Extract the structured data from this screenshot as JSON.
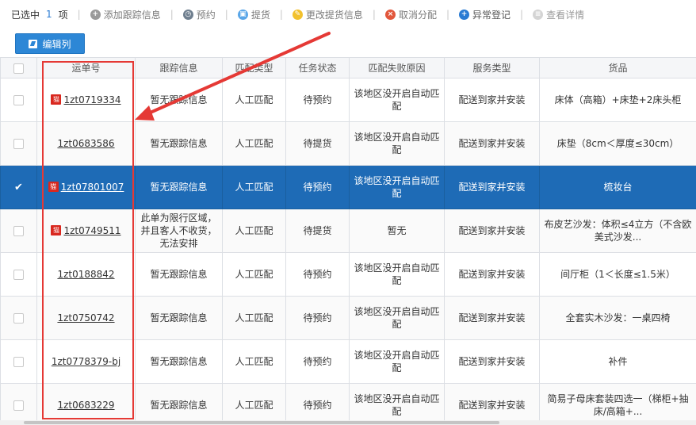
{
  "toolbar": {
    "selected_label": "已选中",
    "selected_count": "1",
    "selected_unit": "项",
    "items": [
      {
        "label": "添加跟踪信息",
        "icon": "add-circle-icon"
      },
      {
        "label": "预约",
        "icon": "clock-icon"
      },
      {
        "label": "提货",
        "icon": "pickup-icon"
      },
      {
        "label": "更改提货信息",
        "icon": "edit-icon"
      },
      {
        "label": "取消分配",
        "icon": "cancel-icon"
      },
      {
        "label": "异常登记",
        "icon": "exception-add-icon"
      },
      {
        "label": "查看详情",
        "icon": "detail-icon"
      }
    ]
  },
  "edit_columns_label": "编辑列",
  "table": {
    "headers": [
      "运单号",
      "跟踪信息",
      "匹配类型",
      "任务状态",
      "匹配失败原因",
      "服务类型",
      "货品"
    ],
    "rows": [
      {
        "tmall": true,
        "waybill": "1zt0719334",
        "tracking": "暂无跟踪信息",
        "match_type": "人工匹配",
        "status": "待预约",
        "fail_reason": "该地区没开启自动匹配",
        "service": "配送到家并安装",
        "goods": "床体（高箱）+床垫+2床头柜"
      },
      {
        "tmall": false,
        "waybill": "1zt0683586",
        "tracking": "暂无跟踪信息",
        "match_type": "人工匹配",
        "status": "待提货",
        "fail_reason": "该地区没开启自动匹配",
        "service": "配送到家并安装",
        "goods": "床垫（8cm＜厚度≤30cm）"
      },
      {
        "tmall": true,
        "waybill": "1zt07801007",
        "tracking": "暂无跟踪信息",
        "match_type": "人工匹配",
        "status": "待预约",
        "fail_reason": "该地区没开启自动匹配",
        "service": "配送到家并安装",
        "goods": "梳妆台",
        "selected": true
      },
      {
        "tmall": true,
        "waybill": "1zt0749511",
        "tracking": "此单为限行区域，并且客人不收货，无法安排",
        "match_type": "人工匹配",
        "status": "待提货",
        "fail_reason": "暂无",
        "service": "配送到家并安装",
        "goods": "布皮艺沙发：体积≤4立方（不含欧美式沙发..."
      },
      {
        "tmall": false,
        "waybill": "1zt0188842",
        "tracking": "暂无跟踪信息",
        "match_type": "人工匹配",
        "status": "待预约",
        "fail_reason": "该地区没开启自动匹配",
        "service": "配送到家并安装",
        "goods": "间厅柜（1＜长度≤1.5米）"
      },
      {
        "tmall": false,
        "waybill": "1zt0750742",
        "tracking": "暂无跟踪信息",
        "match_type": "人工匹配",
        "status": "待预约",
        "fail_reason": "该地区没开启自动匹配",
        "service": "配送到家并安装",
        "goods": "全套实木沙发：一桌四椅"
      },
      {
        "tmall": false,
        "waybill": "1zt0778379-bj",
        "tracking": "暂无跟踪信息",
        "match_type": "人工匹配",
        "status": "待预约",
        "fail_reason": "该地区没开启自动匹配",
        "service": "配送到家并安装",
        "goods": "补件"
      },
      {
        "tmall": false,
        "waybill": "1zt0683229",
        "tracking": "暂无跟踪信息",
        "match_type": "人工匹配",
        "status": "待预约",
        "fail_reason": "该地区没开启自动匹配",
        "service": "配送到家并安装",
        "goods": "简易子母床套装四选一（梯柜+抽床/高箱+..."
      }
    ],
    "tmall_badge": "猫"
  },
  "colors": {
    "selected_row": "#1e6bb6",
    "accent_button": "#2d87d6",
    "annotation": "#e53935",
    "tmall_badge": "#d9281f"
  }
}
